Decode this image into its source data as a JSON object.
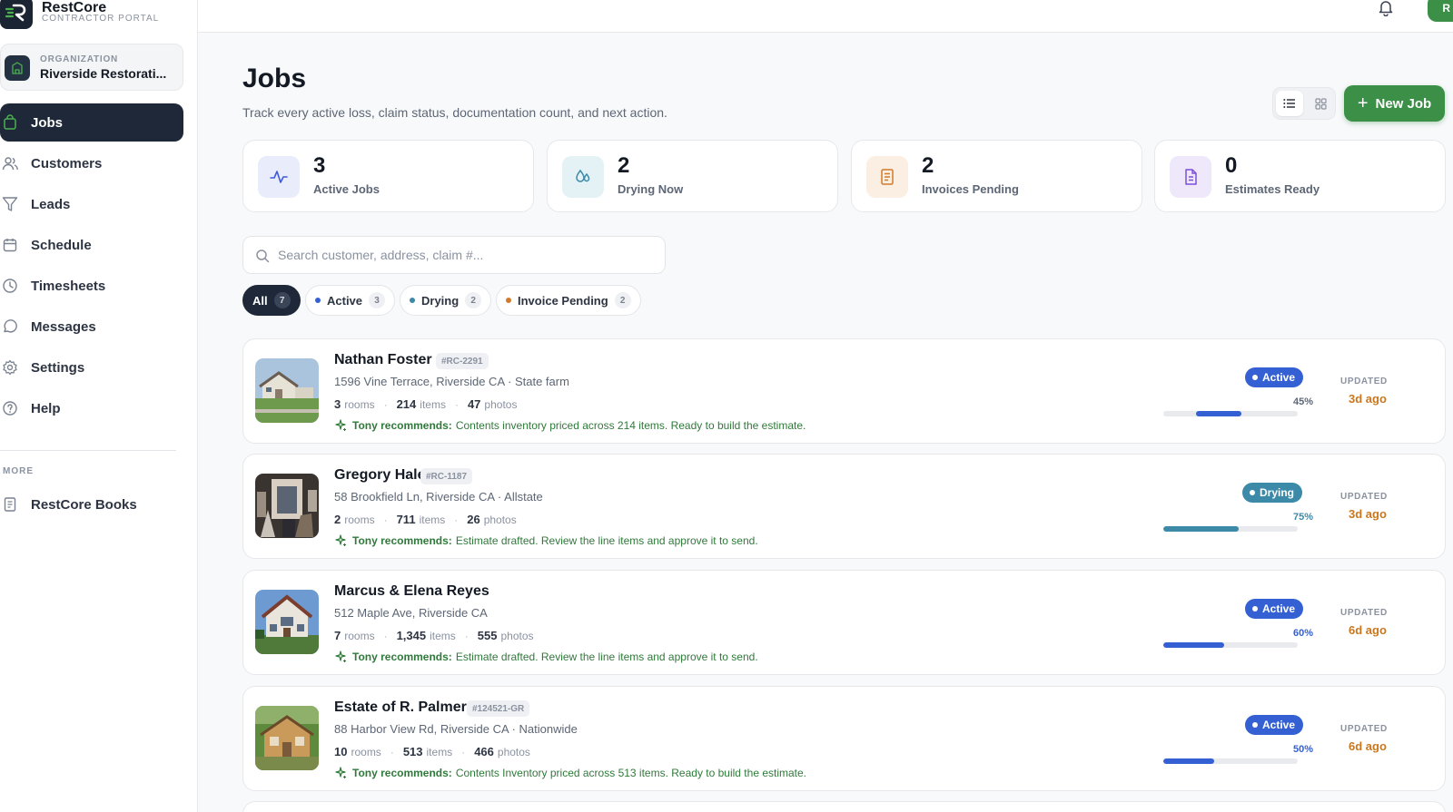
{
  "brand": {
    "name": "RestCore",
    "subtitle": "CONTRACTOR PORTAL"
  },
  "organization": {
    "label": "ORGANIZATION",
    "name": "Riverside Restorati..."
  },
  "sidebar": {
    "items": [
      {
        "label": "Jobs",
        "icon": "bag-icon",
        "active": true
      },
      {
        "label": "Customers",
        "icon": "users-icon"
      },
      {
        "label": "Leads",
        "icon": "filter-icon"
      },
      {
        "label": "Schedule",
        "icon": "calendar-icon"
      },
      {
        "label": "Timesheets",
        "icon": "clock-icon"
      },
      {
        "label": "Messages",
        "icon": "chat-icon"
      },
      {
        "label": "Settings",
        "icon": "gear-icon"
      },
      {
        "label": "Help",
        "icon": "help-icon"
      }
    ],
    "more_label": "MORE",
    "more_items": [
      {
        "label": "RestCore Books",
        "icon": "book-icon"
      }
    ]
  },
  "topbar": {
    "avatar_initial": "R"
  },
  "page": {
    "title": "Jobs",
    "subtitle": "Track every active loss, claim status, documentation count, and next action.",
    "new_job_label": "New Job"
  },
  "stats": [
    {
      "value": "3",
      "label": "Active Jobs",
      "icon": "activity-icon",
      "color": "#3f5bd9",
      "bg": "#e8ecfb"
    },
    {
      "value": "2",
      "label": "Drying Now",
      "icon": "droplets-icon",
      "color": "#3d8aa8",
      "bg": "#e4f1f5"
    },
    {
      "value": "2",
      "label": "Invoices Pending",
      "icon": "receipt-icon",
      "color": "#d27a2b",
      "bg": "#fbeee2"
    },
    {
      "value": "0",
      "label": "Estimates Ready",
      "icon": "document-icon",
      "color": "#7c4fd6",
      "bg": "#efe8fb"
    }
  ],
  "search": {
    "placeholder": "Search customer, address, claim #..."
  },
  "filters": [
    {
      "label": "All",
      "count": "7",
      "dot": ""
    },
    {
      "label": "Active",
      "count": "3",
      "dot": "#3460d4"
    },
    {
      "label": "Drying",
      "count": "2",
      "dot": "#3d8aa8"
    },
    {
      "label": "Invoice Pending",
      "count": "2",
      "dot": "#d27a2b"
    }
  ],
  "jobs": [
    {
      "name": "Nathan Foster",
      "claim": "#RC-2291",
      "address": "1596 Vine Terrace, Riverside CA · State farm",
      "rooms": "3",
      "items": "214",
      "photos": "47",
      "rec_label": "Tony recommends:",
      "rec_text": "Contents inventory priced across 214 items. Ready to build the estimate.",
      "status": "Active",
      "progress": 45,
      "progress_label": "45%",
      "progress_color": "#3460d4",
      "updated_label": "UPDATED",
      "updated": "3d ago"
    },
    {
      "name": "Gregory Hale",
      "claim": "#RC-1187",
      "address": "58 Brookfield Ln, Riverside CA · Allstate",
      "rooms": "2",
      "items": "711",
      "photos": "26",
      "rec_label": "Tony recommends:",
      "rec_text": "Estimate drafted. Review the line items and approve it to send.",
      "status": "Drying",
      "progress": 75,
      "progress_label": "75%",
      "progress_color": "#3d8aa8",
      "updated_label": "UPDATED",
      "updated": "3d ago"
    },
    {
      "name": "Marcus & Elena Reyes",
      "claim": "",
      "address": "512 Maple Ave, Riverside CA",
      "rooms": "7",
      "items": "1,345",
      "photos": "555",
      "rec_label": "Tony recommends:",
      "rec_text": "Estimate drafted. Review the line items and approve it to send.",
      "status": "Active",
      "progress": 60,
      "progress_label": "60%",
      "progress_color": "#3460d4",
      "updated_label": "UPDATED",
      "updated": "6d ago"
    },
    {
      "name": "Estate of R. Palmer",
      "claim": "#124521-GR",
      "address": "88 Harbor View Rd, Riverside CA · Nationwide",
      "rooms": "10",
      "items": "513",
      "photos": "466",
      "rec_label": "Tony recommends:",
      "rec_text": "Contents Inventory priced across 513 items. Ready to build the estimate.",
      "status": "Active",
      "progress": 50,
      "progress_label": "50%",
      "progress_color": "#3460d4",
      "updated_label": "UPDATED",
      "updated": "6d ago"
    }
  ],
  "labels": {
    "rooms": "rooms",
    "items": "items",
    "photos": "photos"
  }
}
